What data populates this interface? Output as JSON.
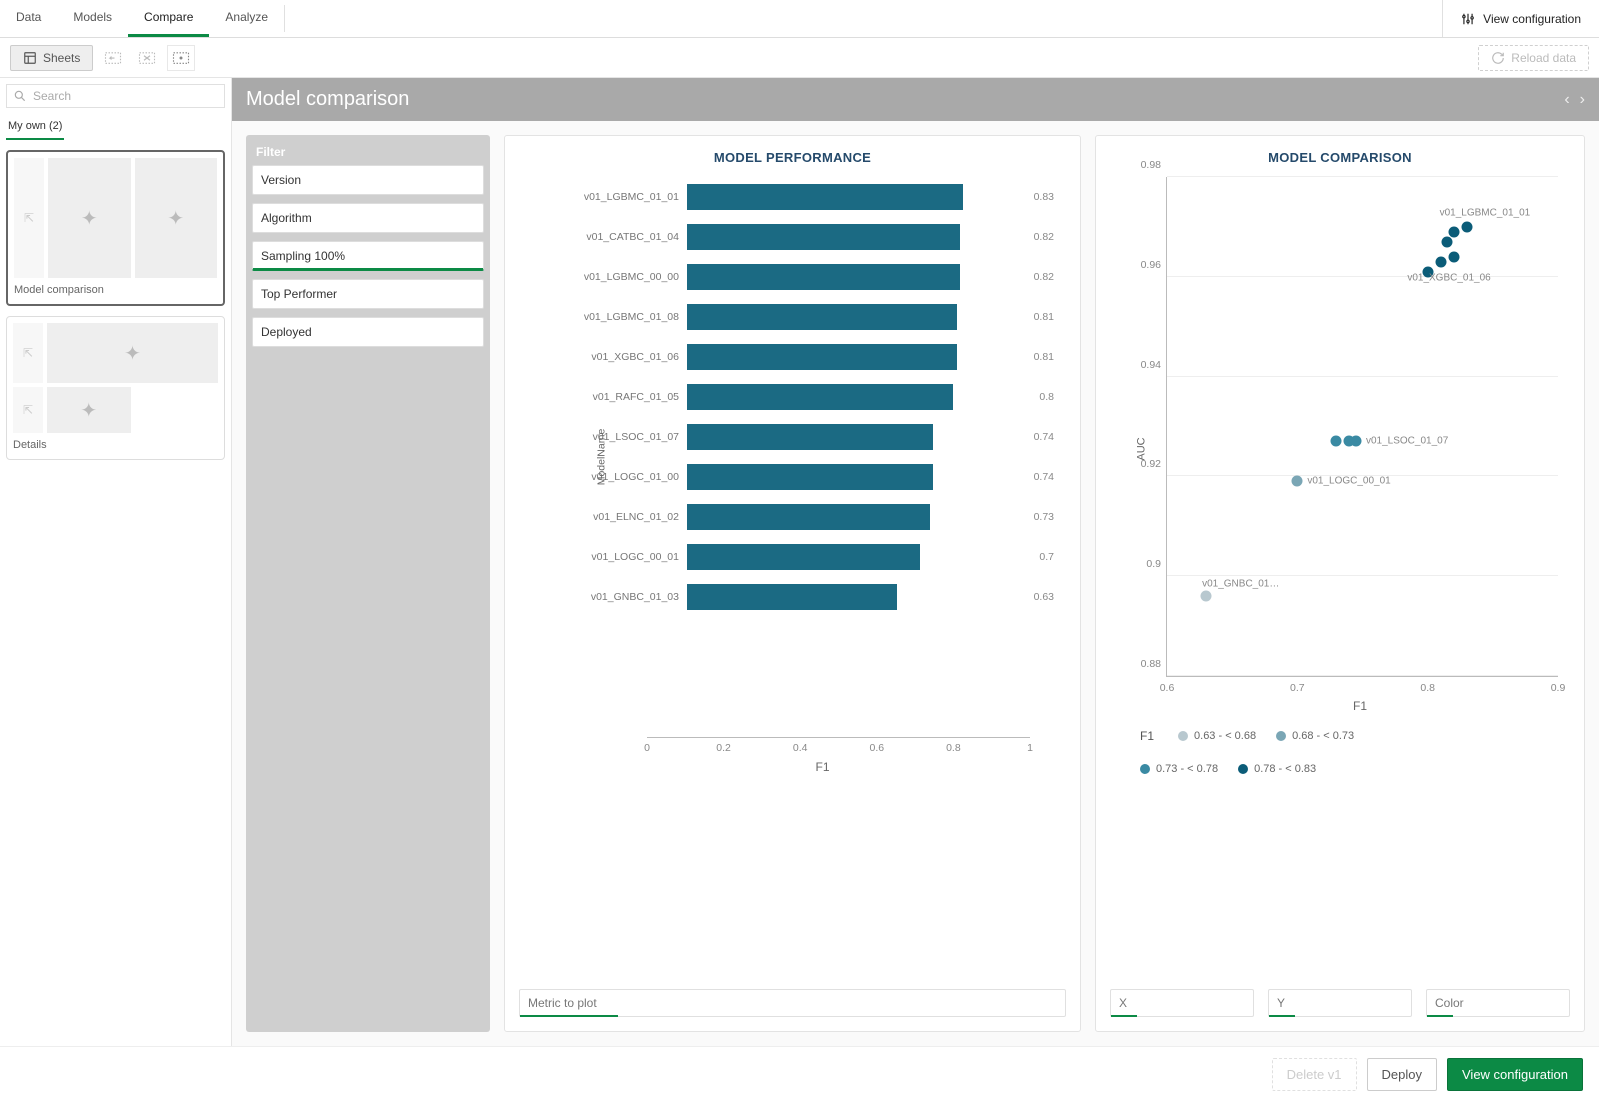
{
  "tabs": {
    "data": "Data",
    "models": "Models",
    "compare": "Compare",
    "analyze": "Analyze",
    "active": "compare"
  },
  "viewConfigTop": "View configuration",
  "toolbar": {
    "sheets": "Sheets",
    "reload": "Reload data"
  },
  "sidebar": {
    "searchPlaceholder": "Search",
    "sideTab": "My own (2)",
    "thumbs": [
      {
        "name": "Model comparison"
      },
      {
        "name": "Details"
      }
    ]
  },
  "page": {
    "title": "Model comparison"
  },
  "filters": {
    "header": "Filter",
    "items": [
      "Version",
      "Algorithm",
      "Sampling 100%",
      "Top Performer",
      "Deployed"
    ],
    "underlined": 2
  },
  "barCard": {
    "title": "MODEL PERFORMANCE",
    "metricBox": "Metric to plot",
    "yTitle": "ModelName",
    "xTitle": "F1"
  },
  "scatterCard": {
    "title": "MODEL COMPARISON",
    "xBox": "X",
    "yBox": "Y",
    "colorBox": "Color",
    "yTitle": "AUC",
    "xTitle": "F1",
    "legendTitle": "F1",
    "legend": [
      {
        "label": "0.63 - < 0.68",
        "color": "#b8c8cf"
      },
      {
        "label": "0.68 - < 0.73",
        "color": "#7aa6b5"
      },
      {
        "label": "0.73 - < 0.78",
        "color": "#3a8aa3"
      },
      {
        "label": "0.78 - < 0.83",
        "color": "#0b5c78"
      }
    ]
  },
  "footer": {
    "delete": "Delete v1",
    "deploy": "Deploy",
    "viewConfig": "View configuration"
  },
  "chart_data": [
    {
      "type": "bar",
      "orientation": "horizontal",
      "title": "MODEL PERFORMANCE",
      "xlabel": "F1",
      "ylabel": "ModelName",
      "xlim": [
        0,
        1
      ],
      "xticks": [
        0,
        0.2,
        0.4,
        0.6,
        0.8,
        1
      ],
      "categories": [
        "v01_LGBMC_01_01",
        "v01_CATBC_01_04",
        "v01_LGBMC_00_00",
        "v01_LGBMC_01_08",
        "v01_XGBC_01_06",
        "v01_RAFC_01_05",
        "v01_LSOC_01_07",
        "v01_LOGC_01_00",
        "v01_ELNC_01_02",
        "v01_LOGC_00_01",
        "v01_GNBC_01_03"
      ],
      "values": [
        0.83,
        0.82,
        0.82,
        0.81,
        0.81,
        0.8,
        0.74,
        0.74,
        0.73,
        0.7,
        0.63
      ]
    },
    {
      "type": "scatter",
      "title": "MODEL COMPARISON",
      "xlabel": "F1",
      "ylabel": "AUC",
      "xlim": [
        0.6,
        0.9
      ],
      "ylim": [
        0.88,
        0.98
      ],
      "xticks": [
        0.6,
        0.7,
        0.8,
        0.9
      ],
      "yticks": [
        0.88,
        0.9,
        0.92,
        0.94,
        0.96,
        0.98
      ],
      "points": [
        {
          "name": "v01_GNBC_01_03",
          "F1": 0.63,
          "AUC": 0.896,
          "bucket": 0,
          "label": "v01_GNBC_01…"
        },
        {
          "name": "v01_LOGC_00_01",
          "F1": 0.7,
          "AUC": 0.919,
          "bucket": 1,
          "label": "v01_LOGC_00_01"
        },
        {
          "name": "v01_ELNC_01_02",
          "F1": 0.73,
          "AUC": 0.927,
          "bucket": 2
        },
        {
          "name": "v01_LOGC_01_00",
          "F1": 0.74,
          "AUC": 0.927,
          "bucket": 2
        },
        {
          "name": "v01_LSOC_01_07",
          "F1": 0.745,
          "AUC": 0.927,
          "bucket": 2,
          "label": "v01_LSOC_01_07"
        },
        {
          "name": "v01_RAFC_01_05",
          "F1": 0.8,
          "AUC": 0.961,
          "bucket": 3
        },
        {
          "name": "v01_XGBC_01_06",
          "F1": 0.81,
          "AUC": 0.963,
          "bucket": 3,
          "label": "v01_XGBC_01_06",
          "labelBelow": true
        },
        {
          "name": "v01_LGBMC_01_08",
          "F1": 0.815,
          "AUC": 0.967,
          "bucket": 3
        },
        {
          "name": "v01_CATBC_01_04",
          "F1": 0.82,
          "AUC": 0.964,
          "bucket": 3
        },
        {
          "name": "v01_LGBMC_00_00",
          "F1": 0.82,
          "AUC": 0.969,
          "bucket": 3
        },
        {
          "name": "v01_LGBMC_01_01",
          "F1": 0.83,
          "AUC": 0.97,
          "bucket": 3,
          "label": "v01_LGBMC_01_01",
          "labelAbove": true
        }
      ],
      "colorBuckets": [
        "#b8c8cf",
        "#7aa6b5",
        "#3a8aa3",
        "#0b5c78"
      ]
    }
  ]
}
